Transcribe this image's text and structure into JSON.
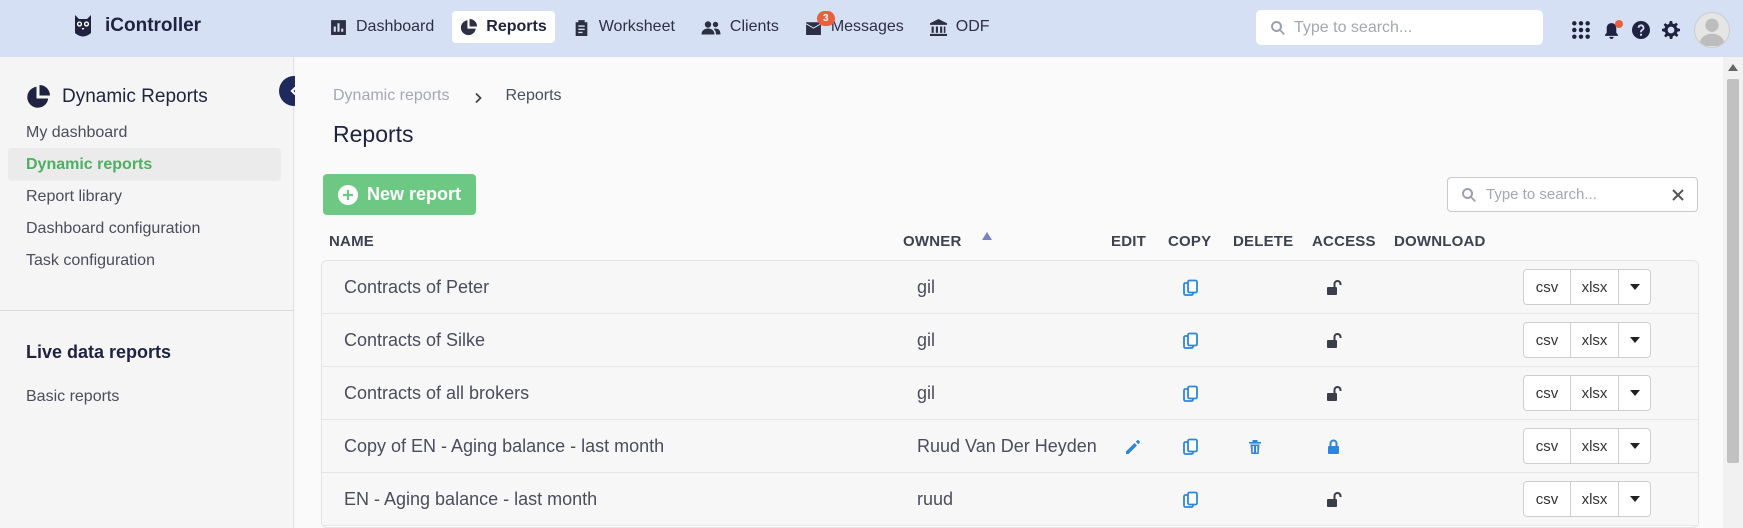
{
  "app": {
    "name": "iController"
  },
  "nav": {
    "items": [
      {
        "label": "Dashboard",
        "icon": "chart-bar-icon"
      },
      {
        "label": "Reports",
        "icon": "pie-chart-icon",
        "active": true
      },
      {
        "label": "Worksheet",
        "icon": "clipboard-icon"
      },
      {
        "label": "Clients",
        "icon": "users-icon"
      },
      {
        "label": "Messages",
        "icon": "mail-icon",
        "badge": "3"
      },
      {
        "label": "ODF",
        "icon": "bank-icon"
      }
    ]
  },
  "top_search": {
    "placeholder": "Type to search..."
  },
  "sidebar": {
    "title": "Dynamic Reports",
    "items": [
      {
        "label": "My dashboard"
      },
      {
        "label": "Dynamic reports",
        "active": true
      },
      {
        "label": "Report library"
      },
      {
        "label": "Dashboard configuration"
      },
      {
        "label": "Task configuration"
      }
    ],
    "section_title": "Live data reports",
    "section_items": [
      {
        "label": "Basic reports"
      }
    ]
  },
  "breadcrumb": {
    "parent": "Dynamic reports",
    "current": "Reports"
  },
  "page": {
    "title": "Reports",
    "new_button": "New report"
  },
  "table_search": {
    "placeholder": "Type to search..."
  },
  "table": {
    "headers": {
      "name": "NAME",
      "owner": "OWNER",
      "edit": "EDIT",
      "copy": "COPY",
      "delete": "DELETE",
      "access": "ACCESS",
      "download": "DOWNLOAD"
    },
    "rows": [
      {
        "name": "Contracts of Peter",
        "owner": "gil",
        "editable": false,
        "deletable": false,
        "access": "unlocked"
      },
      {
        "name": "Contracts of Silke",
        "owner": "gil",
        "editable": false,
        "deletable": false,
        "access": "unlocked"
      },
      {
        "name": "Contracts of all brokers",
        "owner": "gil",
        "editable": false,
        "deletable": false,
        "access": "unlocked"
      },
      {
        "name": "Copy of EN - Aging balance - last month",
        "owner": "Ruud Van Der Heyden",
        "editable": true,
        "deletable": true,
        "access": "locked"
      },
      {
        "name": "EN - Aging balance - last month",
        "owner": "ruud",
        "editable": false,
        "deletable": false,
        "access": "unlocked"
      }
    ],
    "download_options": {
      "csv": "csv",
      "xlsx": "xlsx"
    }
  },
  "colors": {
    "accent_green": "#6dc884",
    "active_green": "#4caf62",
    "nav_bg": "#d6e0f5",
    "icon_blue": "#2f86d9",
    "badge": "#e8603c"
  }
}
